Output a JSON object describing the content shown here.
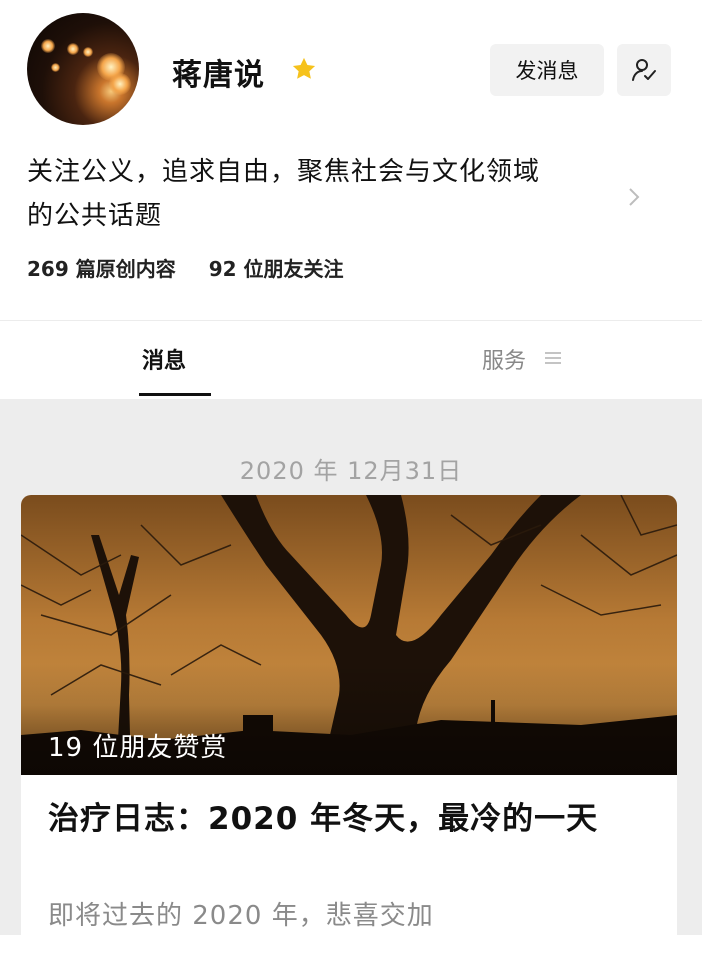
{
  "profile": {
    "name": "蒋唐说",
    "message_button": "发消息",
    "description_line1": "关注公义，追求自由，聚焦社会与文化领域",
    "description_line2": "的公共话题",
    "stats": {
      "articles": "269 篇原创内容",
      "followers": "92 位朋友关注"
    },
    "icons": {
      "star": "star-icon",
      "follow": "user-check-icon",
      "more": "chevron-right-icon"
    }
  },
  "tabs": [
    {
      "label": "消息",
      "active": true
    },
    {
      "label": "服务",
      "active": false,
      "icon": "menu-icon"
    }
  ],
  "feed": {
    "date": "2020 年 12月31日",
    "article": {
      "likes": "19 位朋友赞赏",
      "title": "治疗日志：2020 年冬天，最冷的一天",
      "subtitle": "即将过去的 2020 年，悲喜交加"
    }
  },
  "colors": {
    "star": "#f6c21c",
    "accent_dark": "#111111",
    "muted": "#888888",
    "feed_bg": "#ededed"
  }
}
